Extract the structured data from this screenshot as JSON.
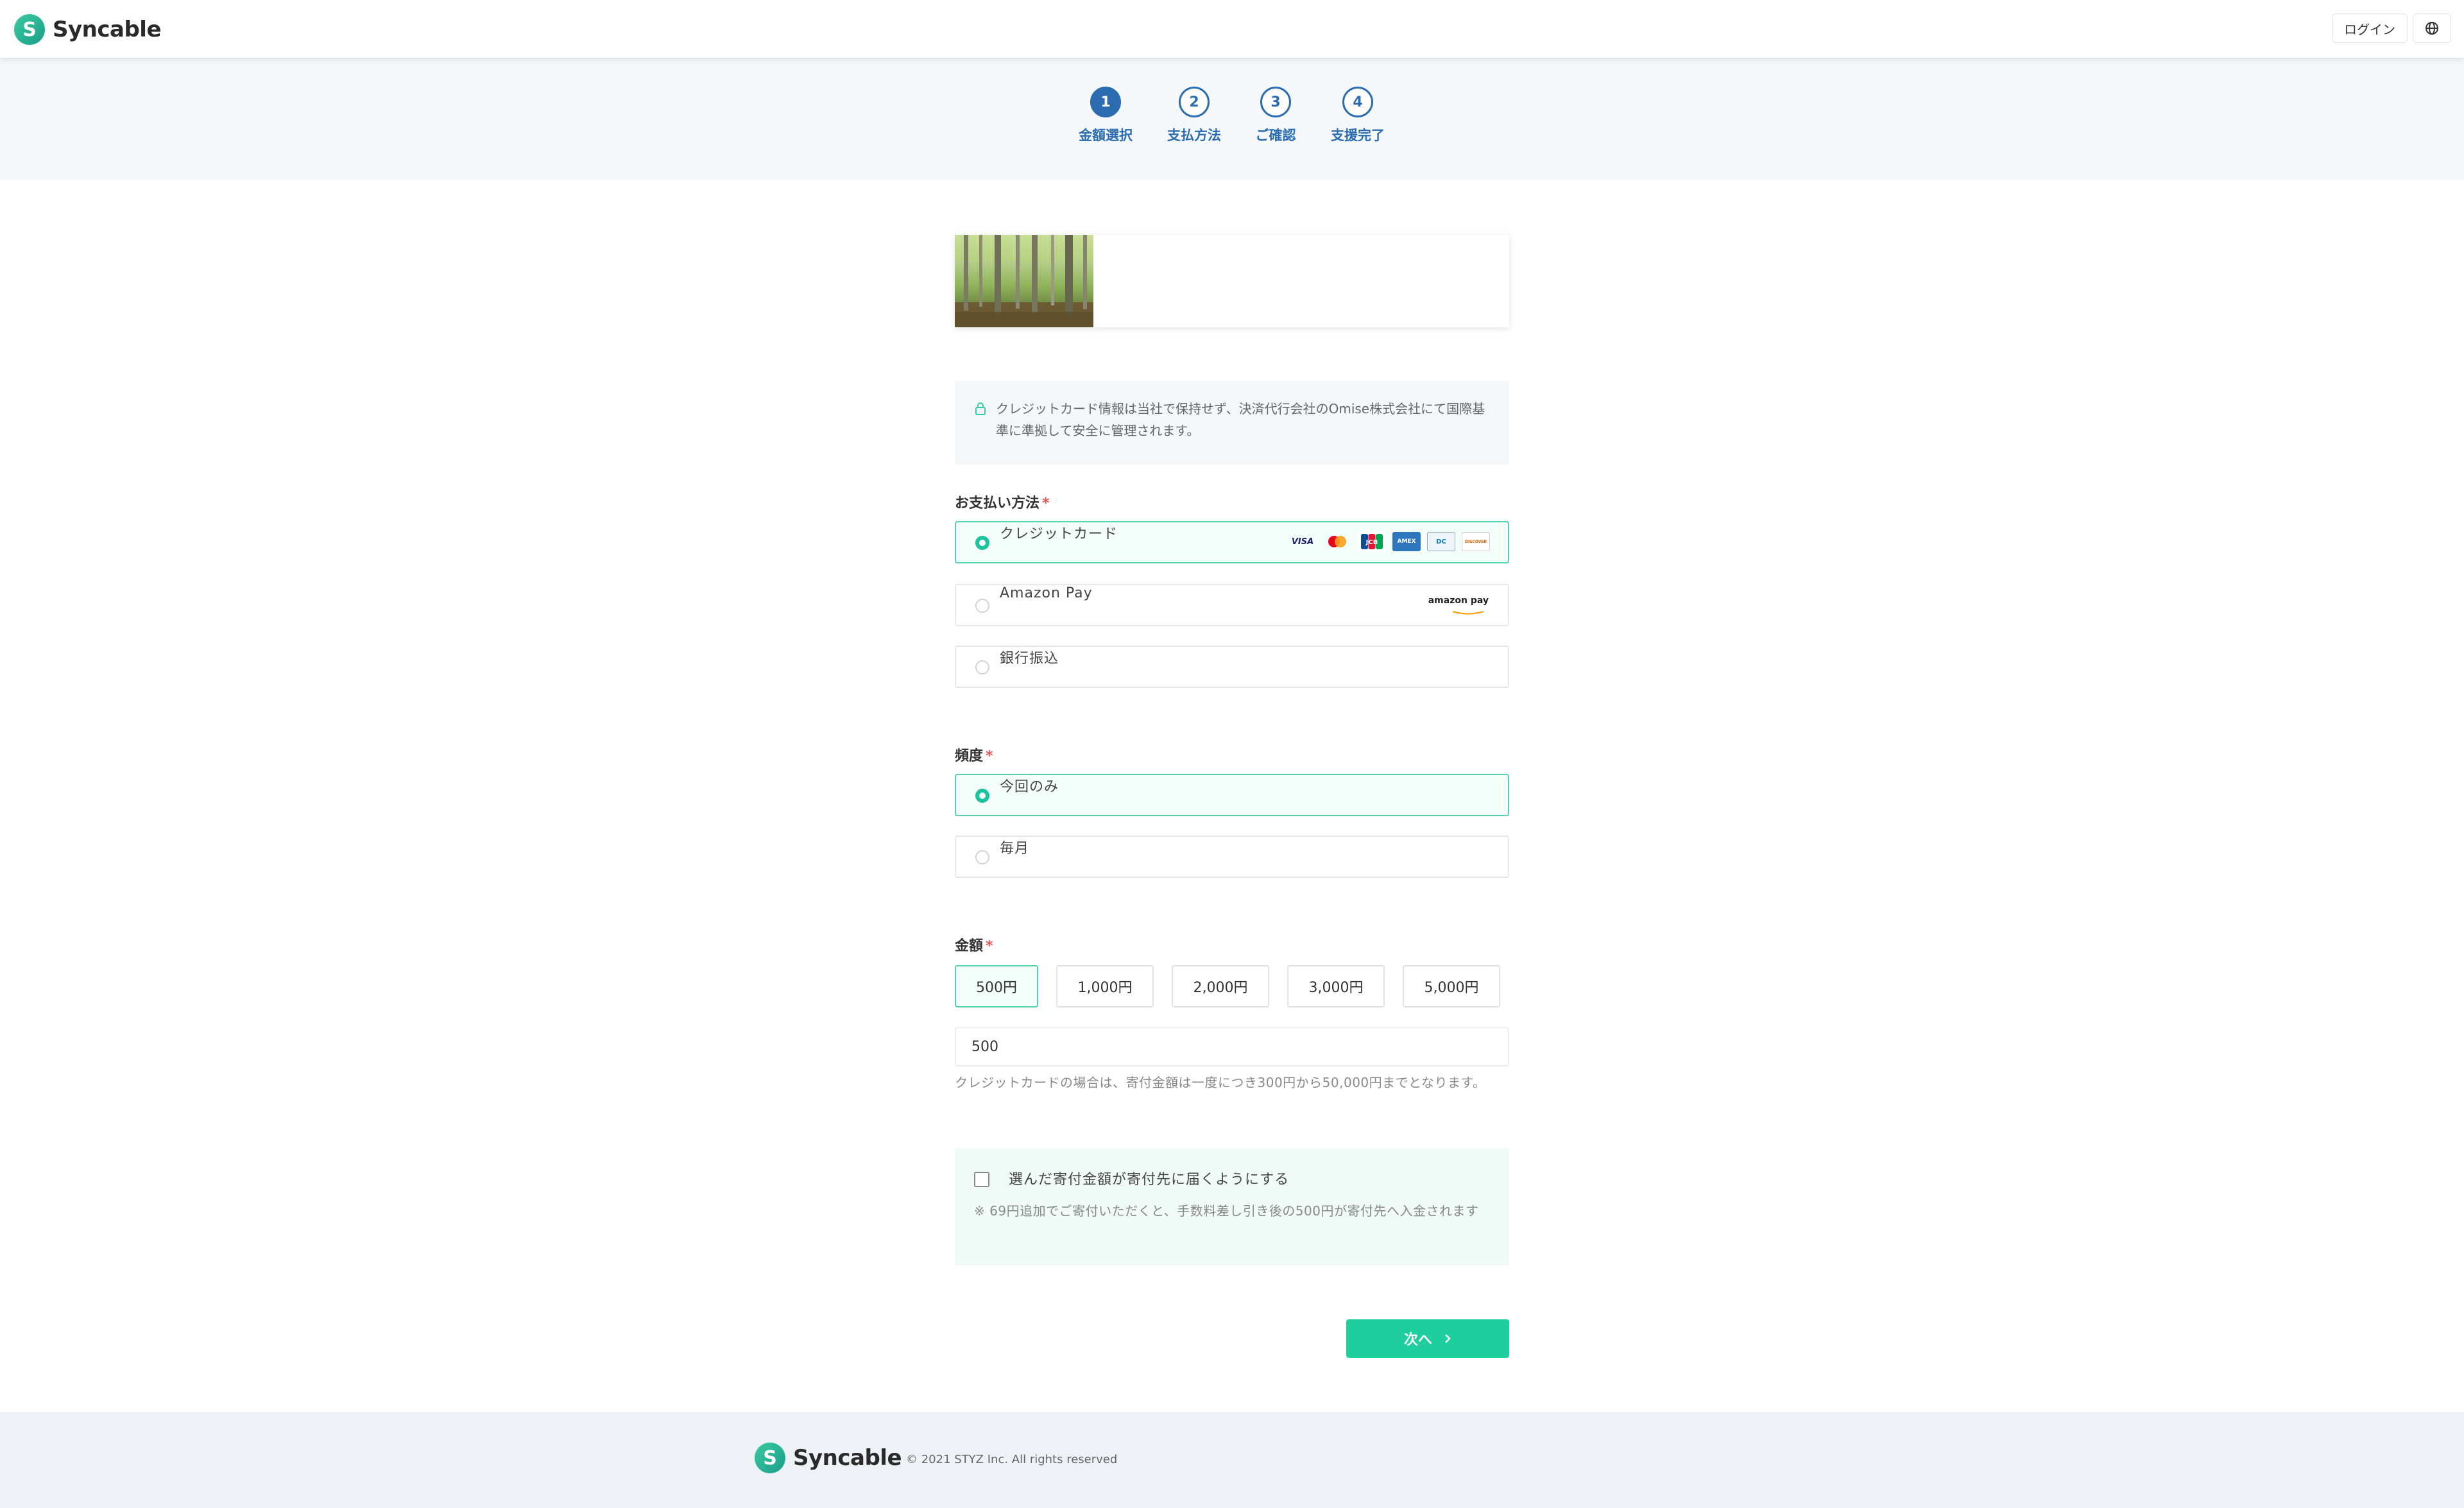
{
  "header": {
    "brand": "Syncable",
    "brand_mark": "S",
    "login_label": "ログイン",
    "language_icon": "globe-icon"
  },
  "steps": [
    {
      "number": "1",
      "label": "金額選択",
      "active": true
    },
    {
      "number": "2",
      "label": "支払方法",
      "active": false
    },
    {
      "number": "3",
      "label": "ご確認",
      "active": false
    },
    {
      "number": "4",
      "label": "支援完了",
      "active": false
    }
  ],
  "notice": {
    "text": "クレジットカード情報は当社で保持せず、決済代行会社のOmise株式会社にて国際基準に準拠して安全に管理されます。",
    "icon": "lock-icon"
  },
  "payment": {
    "label": "お支払い方法",
    "required_mark": "*",
    "options": [
      {
        "label": "クレジットカード",
        "selected": true
      },
      {
        "label": "Amazon Pay",
        "selected": false
      },
      {
        "label": "銀行振込",
        "selected": false
      }
    ],
    "card_brands": {
      "visa": "VISA",
      "jcb": "JCB",
      "amex": "AMEX",
      "diners": "DC",
      "discover": "DISCOVER"
    },
    "amazon_logo_text": "amazon pay"
  },
  "frequency": {
    "label": "頻度",
    "required_mark": "*",
    "options": [
      {
        "label": "今回のみ",
        "selected": true
      },
      {
        "label": "毎月",
        "selected": false
      }
    ]
  },
  "amount": {
    "label": "金額",
    "required_mark": "*",
    "presets": [
      "500円",
      "1,000円",
      "2,000円",
      "3,000円",
      "5,000円"
    ],
    "selected_index": 0,
    "input_value": "500",
    "hint": "クレジットカードの場合は、寄付金額は一度につき300円から50,000円までとなります。"
  },
  "fee": {
    "checkbox_label": "選んだ寄付金額が寄付先に届くようにする",
    "checked": false,
    "note": "※ 69円追加でご寄付いただくと、手数料差し引き後の500円が寄付先へ入金されます"
  },
  "next_button": "次へ",
  "footer": {
    "brand": "Syncable",
    "copyright": "© 2021 STYZ Inc. All rights reserved"
  },
  "colors": {
    "accent": "#1ecf9d",
    "step": "#2b6cb0",
    "selected_border": "#54d1ad"
  }
}
